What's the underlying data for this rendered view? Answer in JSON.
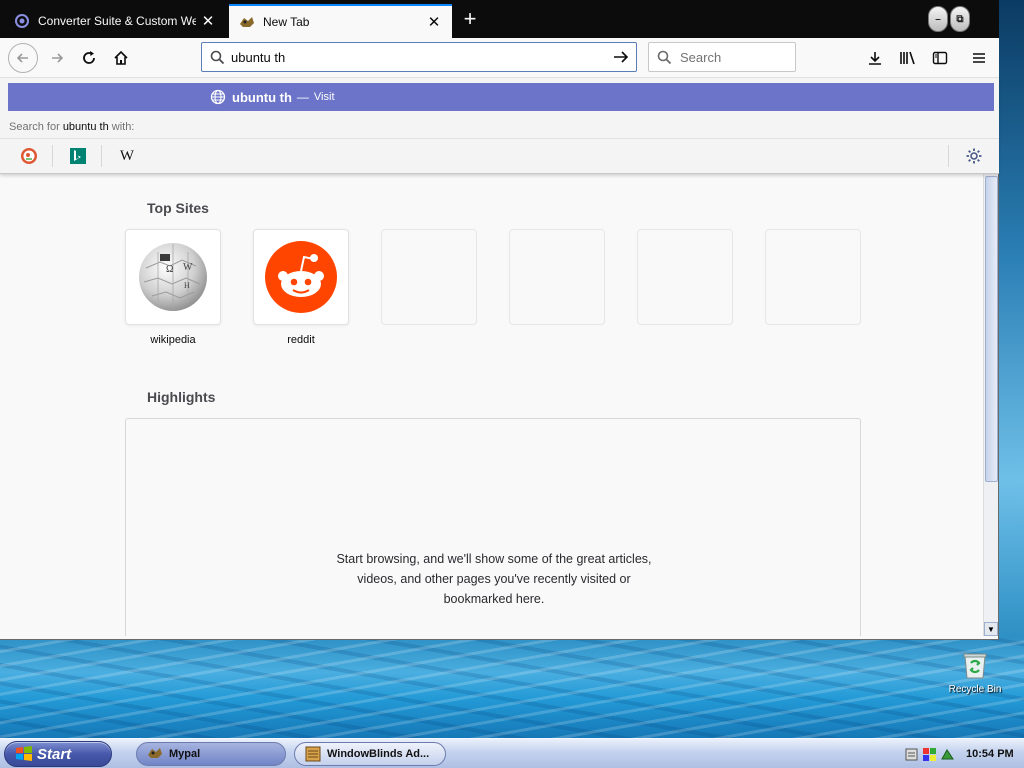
{
  "browser": {
    "tabs": [
      {
        "title": "Converter Suite & Custom Web Se",
        "favicon": "converter-suite-favicon",
        "active": false
      },
      {
        "title": "New Tab",
        "favicon": "mypal-tab-favicon",
        "active": true
      }
    ],
    "new_tab_icon": "plus-icon",
    "url_value": "ubuntu th",
    "search_placeholder": "Search"
  },
  "url_popup": {
    "suggestion_text": "ubuntu th",
    "suggestion_separator": "—",
    "suggestion_action": "Visit",
    "search_with_prefix": "Search for",
    "search_with_query": "ubuntu th",
    "search_with_suffix": "with:",
    "engines": [
      "duckduckgo",
      "bing",
      "wikipedia"
    ],
    "wikipedia_glyph": "W"
  },
  "new_tab": {
    "top_sites_title": "Top Sites",
    "top_sites": [
      {
        "label": "wikipedia"
      },
      {
        "label": "reddit"
      },
      {
        "label": ""
      },
      {
        "label": ""
      },
      {
        "label": ""
      },
      {
        "label": ""
      }
    ],
    "highlights_title": "Highlights",
    "highlights_message_lines": [
      "Start browsing, and we'll show some of the great articles,",
      "videos, and other pages you've recently visited or",
      "bookmarked here."
    ]
  },
  "desktop": {
    "recycle_bin_label": "Recycle Bin"
  },
  "taskbar": {
    "start_label": "Start",
    "tasks": [
      {
        "label": "Mypal",
        "active": true
      },
      {
        "label": "WindowBlinds Ad...",
        "active": false
      }
    ],
    "clock": "10:54 PM"
  },
  "colors": {
    "suggestion_highlight": "#6b74c9",
    "active_tab_accent": "#0a84ff",
    "reddit_orange": "#ff4500"
  }
}
